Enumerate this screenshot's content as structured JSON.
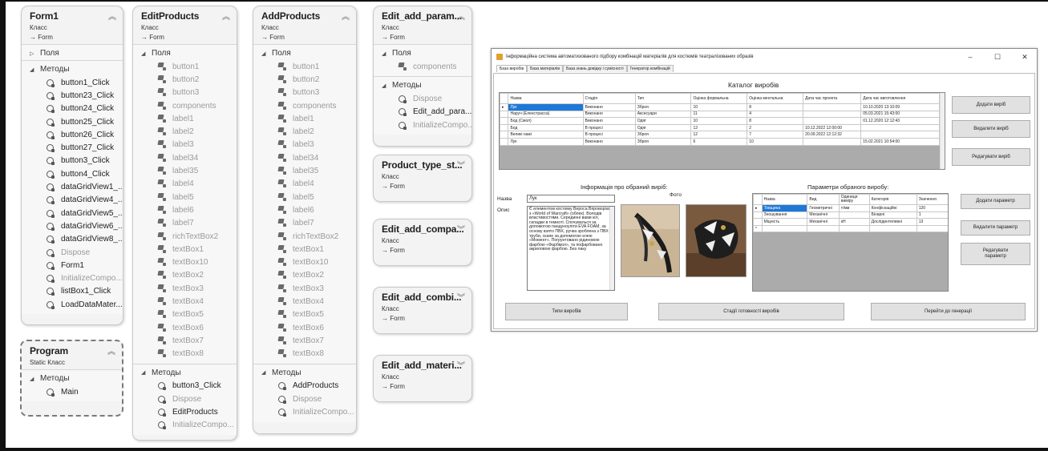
{
  "class_diagram": {
    "classes": [
      {
        "id": "form1",
        "title": "Form1",
        "kind": "Класс",
        "base": "Form",
        "fields_label": "Поля",
        "fields_collapsed": true,
        "fields": [],
        "methods_label": "Методы",
        "methods": [
          {
            "name": "button1_Click",
            "gray": false
          },
          {
            "name": "button23_Click",
            "gray": false
          },
          {
            "name": "button24_Click",
            "gray": false
          },
          {
            "name": "button25_Click",
            "gray": false
          },
          {
            "name": "button26_Click",
            "gray": false
          },
          {
            "name": "button27_Click",
            "gray": false
          },
          {
            "name": "button3_Click",
            "gray": false
          },
          {
            "name": "button4_Click",
            "gray": false
          },
          {
            "name": "dataGridView1_...",
            "gray": false
          },
          {
            "name": "dataGridView4_...",
            "gray": false
          },
          {
            "name": "dataGridView5_...",
            "gray": false
          },
          {
            "name": "dataGridView6_...",
            "gray": false
          },
          {
            "name": "dataGridView8_...",
            "gray": false
          },
          {
            "name": "Dispose",
            "gray": true
          },
          {
            "name": "Form1",
            "gray": false
          },
          {
            "name": "InitializeCompo...",
            "gray": true
          },
          {
            "name": "listBox1_Click",
            "gray": false
          },
          {
            "name": "LoadDataMater...",
            "gray": false
          }
        ]
      },
      {
        "id": "editproducts",
        "title": "EditProducts",
        "kind": "Класс",
        "base": "Form",
        "fields_label": "Поля",
        "fields_collapsed": false,
        "fields": [
          "button1",
          "button2",
          "button3",
          "components",
          "label1",
          "label2",
          "label3",
          "label34",
          "label35",
          "label4",
          "label5",
          "label6",
          "label7",
          "richTextBox2",
          "textBox1",
          "textBox10",
          "textBox2",
          "textBox3",
          "textBox4",
          "textBox5",
          "textBox6",
          "textBox7",
          "textBox8"
        ],
        "methods_label": "Методы",
        "methods": [
          {
            "name": "button3_Click",
            "gray": false
          },
          {
            "name": "Dispose",
            "gray": true
          },
          {
            "name": "EditProducts",
            "gray": false
          },
          {
            "name": "InitializeCompo...",
            "gray": true
          }
        ]
      },
      {
        "id": "addproducts",
        "title": "AddProducts",
        "kind": "Класс",
        "base": "Form",
        "fields_label": "Поля",
        "fields_collapsed": false,
        "fields": [
          "button1",
          "button2",
          "button3",
          "components",
          "label1",
          "label2",
          "label3",
          "label34",
          "label35",
          "label4",
          "label5",
          "label6",
          "label7",
          "richTextBox2",
          "textBox1",
          "textBox10",
          "textBox2",
          "textBox3",
          "textBox4",
          "textBox5",
          "textBox6",
          "textBox7",
          "textBox8"
        ],
        "methods_label": "Методы",
        "methods": [
          {
            "name": "AddProducts",
            "gray": false
          },
          {
            "name": "Dispose",
            "gray": true
          },
          {
            "name": "InitializeCompo...",
            "gray": true
          }
        ]
      },
      {
        "id": "editaddparam",
        "title": "Edit_add_param...",
        "kind": "Класс",
        "base": "Form",
        "fields_label": "Поля",
        "fields": [
          "components"
        ],
        "methods_label": "Методы",
        "methods": [
          {
            "name": "Dispose",
            "gray": true
          },
          {
            "name": "Edit_add_para...",
            "gray": false
          },
          {
            "name": "InitializeCompo...",
            "gray": true
          }
        ]
      },
      {
        "id": "producttype",
        "title": "Product_type_st...",
        "kind": "Класс",
        "base": "Form"
      },
      {
        "id": "editaddcompa",
        "title": "Edit_add_compa...",
        "kind": "Класс",
        "base": "Form"
      },
      {
        "id": "editaddcombi",
        "title": "Edit_add_combi...",
        "kind": "Класс",
        "base": "Form"
      },
      {
        "id": "editaddmateri",
        "title": "Edit_add_materi...",
        "kind": "Класс",
        "base": "Form"
      },
      {
        "id": "program",
        "title": "Program",
        "kind": "Static Класс",
        "methods_label": "Методы",
        "methods": [
          {
            "name": "Main",
            "gray": false
          }
        ]
      }
    ]
  },
  "app": {
    "title": "Інформаційна система автоматизованого підбору комбінацій матеріалів для костюмів театралізованих образів",
    "tabs": [
      "База виробів",
      "База матеріалів",
      "База знань довідку і сумісності",
      "Генератор комбінацій"
    ],
    "catalog_title": "Каталог виробів",
    "products_columns": [
      "Назва",
      "Стадія",
      "Тип",
      "Оцінка формальна",
      "Оцінка ментальна",
      "Дата час проекта",
      "Дата час виготовлення"
    ],
    "products_rows": [
      [
        "Лук",
        "Виконано",
        "Зброя",
        "10",
        "8",
        "",
        "10.10.2020 13:10:09"
      ],
      [
        "Наруч (Еленстрасса)",
        "Виконано",
        "Аксесуари",
        "11",
        "4",
        "",
        "05.03.2021 15:43:00"
      ],
      [
        "Бод (Смол)",
        "Виконано",
        "Одяг",
        "10",
        "8",
        "",
        "01.12.2020 12:12:43"
      ],
      [
        "Бод",
        "В процесі",
        "Одяг",
        "12",
        "2",
        "10.12.2022 12:00:00",
        ""
      ],
      [
        "Великі нажі",
        "В процесі",
        "Зброя",
        "12",
        "7",
        "20.09.2022 12:12:32",
        ""
      ],
      [
        "Лук",
        "Виконано",
        "Зброя",
        "6",
        "10",
        "",
        "15.02.2021 10:54:00"
      ]
    ],
    "right_buttons": [
      "Додати виріб",
      "Видалити виріб",
      "Редагувати виріб"
    ],
    "info_title": "Інформація про обраний виріб:",
    "name_label": "Назва",
    "name_value": "Лук",
    "desc_label": "Опис",
    "desc_text": "Є елементом костюму Вероса Впроворіата з «World of Warcraft» (облек). Володів властивостями. Серединні вами кіл, складки в темноті. Спочувалься за допомогою пандуноуліти EVA FOAM, за основу взято ПВХ, ручка зроблена з ПВХ труби, скапе за допомогою клею «Момент». Погрунтовано рідиновою фарбою «Фарбмол», та пофарбовано акриловою фарбою. Без лаку",
    "photo_label": "Фото",
    "params_title": "Параметри обраного виробу:",
    "params_columns": [
      "Назва",
      "Вид",
      "Одиниця виміру",
      "Категорія",
      "Значення"
    ],
    "params_rows": [
      [
        "Товщина",
        "Геометричні",
        "т/мм",
        "Конфіскаційні",
        "120"
      ],
      [
        "Зношування",
        "Механічні",
        "",
        "Бінарні",
        "1"
      ],
      [
        "Міцність",
        "Механічні",
        "кН",
        "Дослідинтелевні",
        "13"
      ]
    ],
    "param_buttons": [
      "Додати параметр",
      "Видалити параметр",
      "Редагувати параметр"
    ],
    "bottom_buttons": [
      "Типи виробів",
      "Стадії готовності виробів",
      "Перейти до генерації"
    ],
    "window_controls": [
      "–",
      "☐",
      "✕"
    ]
  }
}
